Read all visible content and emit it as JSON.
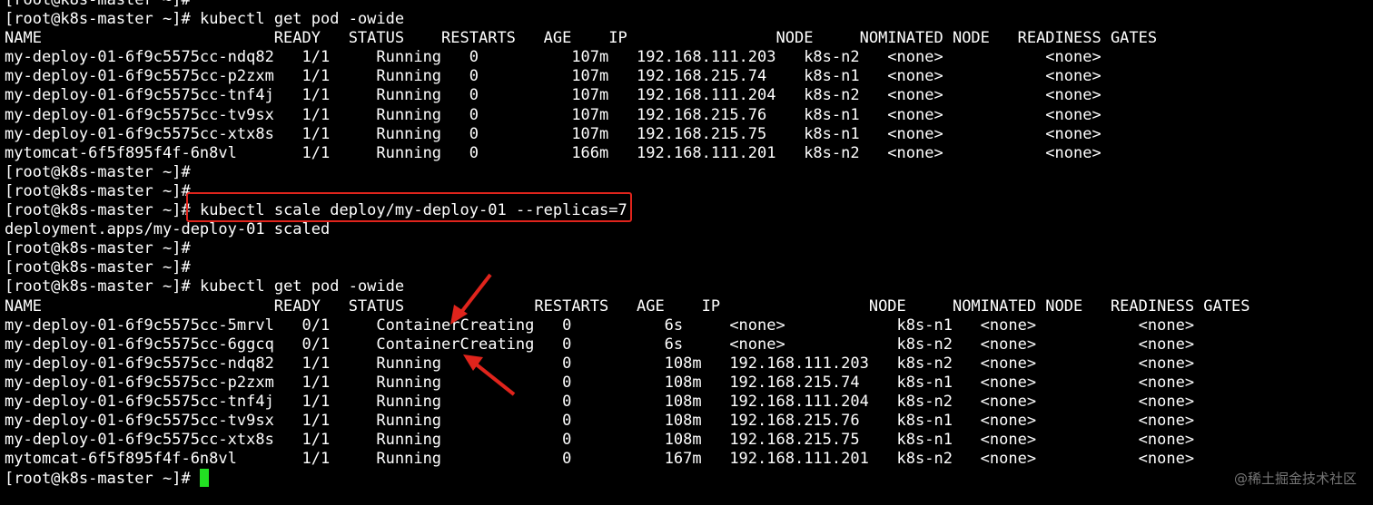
{
  "prompt": "[root@k8s-master ~]#",
  "first_top_line": "[root@k8s-master ~]#",
  "command_get_pod": "kubectl get pod -owide",
  "command_scale": "kubectl scale deploy/my-deploy-01 --replicas=7",
  "scale_output": "deployment.apps/my-deploy-01 scaled",
  "table1": {
    "header": "NAME                         READY   STATUS    RESTARTS   AGE    IP                NODE     NOMINATED NODE   READINESS GATES",
    "rows": [
      "my-deploy-01-6f9c5575cc-ndq82   1/1     Running   0          107m   192.168.111.203   k8s-n2   <none>           <none>",
      "my-deploy-01-6f9c5575cc-p2zxm   1/1     Running   0          107m   192.168.215.74    k8s-n1   <none>           <none>",
      "my-deploy-01-6f9c5575cc-tnf4j   1/1     Running   0          107m   192.168.111.204   k8s-n2   <none>           <none>",
      "my-deploy-01-6f9c5575cc-tv9sx   1/1     Running   0          107m   192.168.215.76    k8s-n1   <none>           <none>",
      "my-deploy-01-6f9c5575cc-xtx8s   1/1     Running   0          107m   192.168.215.75    k8s-n1   <none>           <none>",
      "mytomcat-6f5f895f4f-6n8vl       1/1     Running   0          166m   192.168.111.201   k8s-n2   <none>           <none>"
    ]
  },
  "table2": {
    "header": "NAME                         READY   STATUS              RESTARTS   AGE    IP                NODE     NOMINATED NODE   READINESS GATES",
    "rows": [
      "my-deploy-01-6f9c5575cc-5mrvl   0/1     ContainerCreating   0          6s     <none>            k8s-n1   <none>           <none>",
      "my-deploy-01-6f9c5575cc-6ggcq   0/1     ContainerCreating   0          6s     <none>            k8s-n2   <none>           <none>",
      "my-deploy-01-6f9c5575cc-ndq82   1/1     Running             0          108m   192.168.111.203   k8s-n2   <none>           <none>",
      "my-deploy-01-6f9c5575cc-p2zxm   1/1     Running             0          108m   192.168.215.74    k8s-n1   <none>           <none>",
      "my-deploy-01-6f9c5575cc-tnf4j   1/1     Running             0          108m   192.168.111.204   k8s-n2   <none>           <none>",
      "my-deploy-01-6f9c5575cc-tv9sx   1/1     Running             0          108m   192.168.215.76    k8s-n1   <none>           <none>",
      "my-deploy-01-6f9c5575cc-xtx8s   1/1     Running             0          108m   192.168.215.75    k8s-n1   <none>           <none>",
      "mytomcat-6f5f895f4f-6n8vl       1/1     Running             0          167m   192.168.111.201   k8s-n2   <none>           <none>"
    ]
  },
  "watermark": "@稀土掘金技术社区",
  "colors": {
    "background": "#000000",
    "text": "#ffffff",
    "highlight_box": "#e0241c",
    "arrow": "#e0241c",
    "cursor": "#22e022"
  },
  "icons": {
    "arrow_annotation": "red-arrow-icon",
    "cursor": "block-cursor"
  }
}
